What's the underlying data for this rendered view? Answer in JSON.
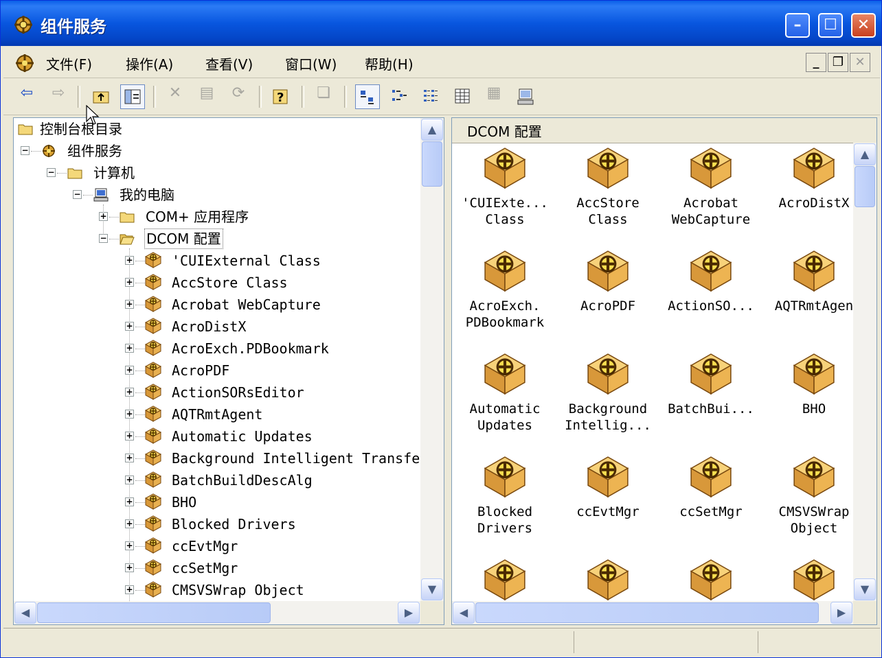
{
  "window": {
    "title": "组件服务"
  },
  "menu": [
    {
      "label": "文件(F)"
    },
    {
      "label": "操作(A)"
    },
    {
      "label": "查看(V)"
    },
    {
      "label": "窗口(W)"
    },
    {
      "label": "帮助(H)"
    }
  ],
  "tree": {
    "root": "控制台根目录",
    "component_services": "组件服务",
    "computers": "计算机",
    "my_computer": "我的电脑",
    "complus_apps": "COM+ 应用程序",
    "dcom_config": "DCOM 配置",
    "items": [
      "'CUIExternal Class",
      "AccStore Class",
      "Acrobat WebCapture",
      "AcroDistX",
      "AcroExch.PDBookmark",
      "AcroPDF",
      "ActionSORsEditor",
      "AQTRmtAgent",
      "Automatic Updates",
      "Background Intelligent Transfe",
      "BatchBuildDescAlg",
      "BHO",
      "Blocked Drivers",
      "ccEvtMgr",
      "ccSetMgr",
      "CMSVSWrap Object"
    ]
  },
  "right_pane": {
    "header": "DCOM 配置",
    "icons": [
      {
        "l1": "'CUIExte...",
        "l2": "Class"
      },
      {
        "l1": "AccStore",
        "l2": "Class"
      },
      {
        "l1": "Acrobat",
        "l2": "WebCapture"
      },
      {
        "l1": "AcroDistX",
        "l2": ""
      },
      {
        "l1": "AcroExch.",
        "l2": "PDBookmark"
      },
      {
        "l1": "AcroPDF",
        "l2": ""
      },
      {
        "l1": "ActionSO...",
        "l2": ""
      },
      {
        "l1": "AQTRmtAgen",
        "l2": ""
      },
      {
        "l1": "Automatic",
        "l2": "Updates"
      },
      {
        "l1": "Background",
        "l2": "Intellig..."
      },
      {
        "l1": "BatchBui...",
        "l2": ""
      },
      {
        "l1": "BHO",
        "l2": ""
      },
      {
        "l1": "Blocked",
        "l2": "Drivers"
      },
      {
        "l1": "ccEvtMgr",
        "l2": ""
      },
      {
        "l1": "ccSetMgr",
        "l2": ""
      },
      {
        "l1": "CMSVSWrap",
        "l2": "Object"
      },
      {
        "l1": "",
        "l2": ""
      },
      {
        "l1": "",
        "l2": ""
      },
      {
        "l1": "",
        "l2": ""
      },
      {
        "l1": "",
        "l2": ""
      }
    ]
  },
  "colors": {
    "titlebar": "#0A5FE8",
    "face": "#ECE9D8",
    "box": "#E8B45A"
  }
}
